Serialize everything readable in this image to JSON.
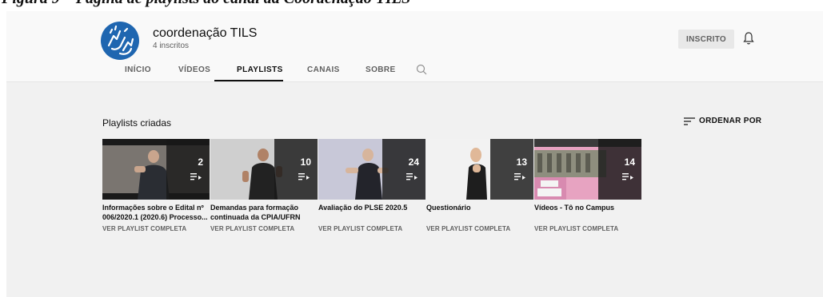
{
  "document": {
    "caption": "Figura 9 – Página de playlists do canal da Coordenação TILS"
  },
  "channel": {
    "name": "coordenação TILS",
    "subscribers": "4 inscritos",
    "subscribe_label": "INSCRITO"
  },
  "tabs": [
    {
      "label": "INÍCIO"
    },
    {
      "label": "VÍDEOS"
    },
    {
      "label": "PLAYLISTS",
      "active": true
    },
    {
      "label": "CANAIS"
    },
    {
      "label": "SOBRE"
    }
  ],
  "section": {
    "title": "Playlists criadas",
    "sort_label": "ORDENAR POR"
  },
  "playlists": [
    {
      "count": "2",
      "title": "Informações sobre o Edital nº 006/2020.1 (2020.6) Processo...",
      "link": "VER PLAYLIST COMPLETA"
    },
    {
      "count": "10",
      "title": "Demandas para formação continuada da CPIA/UFRN",
      "link": "VER PLAYLIST COMPLETA"
    },
    {
      "count": "24",
      "title": "Avaliação do PLSE 2020.5",
      "link": "VER PLAYLIST COMPLETA"
    },
    {
      "count": "13",
      "title": "Questionário",
      "link": "VER PLAYLIST COMPLETA"
    },
    {
      "count": "14",
      "title": "Vídeos - Tô no Campus",
      "link": "VER PLAYLIST COMPLETA"
    }
  ],
  "colors": {
    "avatar": "#1f66b0",
    "page_bg": "#f1f1f1",
    "header_bg": "#f9f9f9"
  },
  "icons": [
    "sign-language-avatar",
    "bell-icon",
    "search-icon",
    "sort-icon",
    "playlist-icon"
  ]
}
